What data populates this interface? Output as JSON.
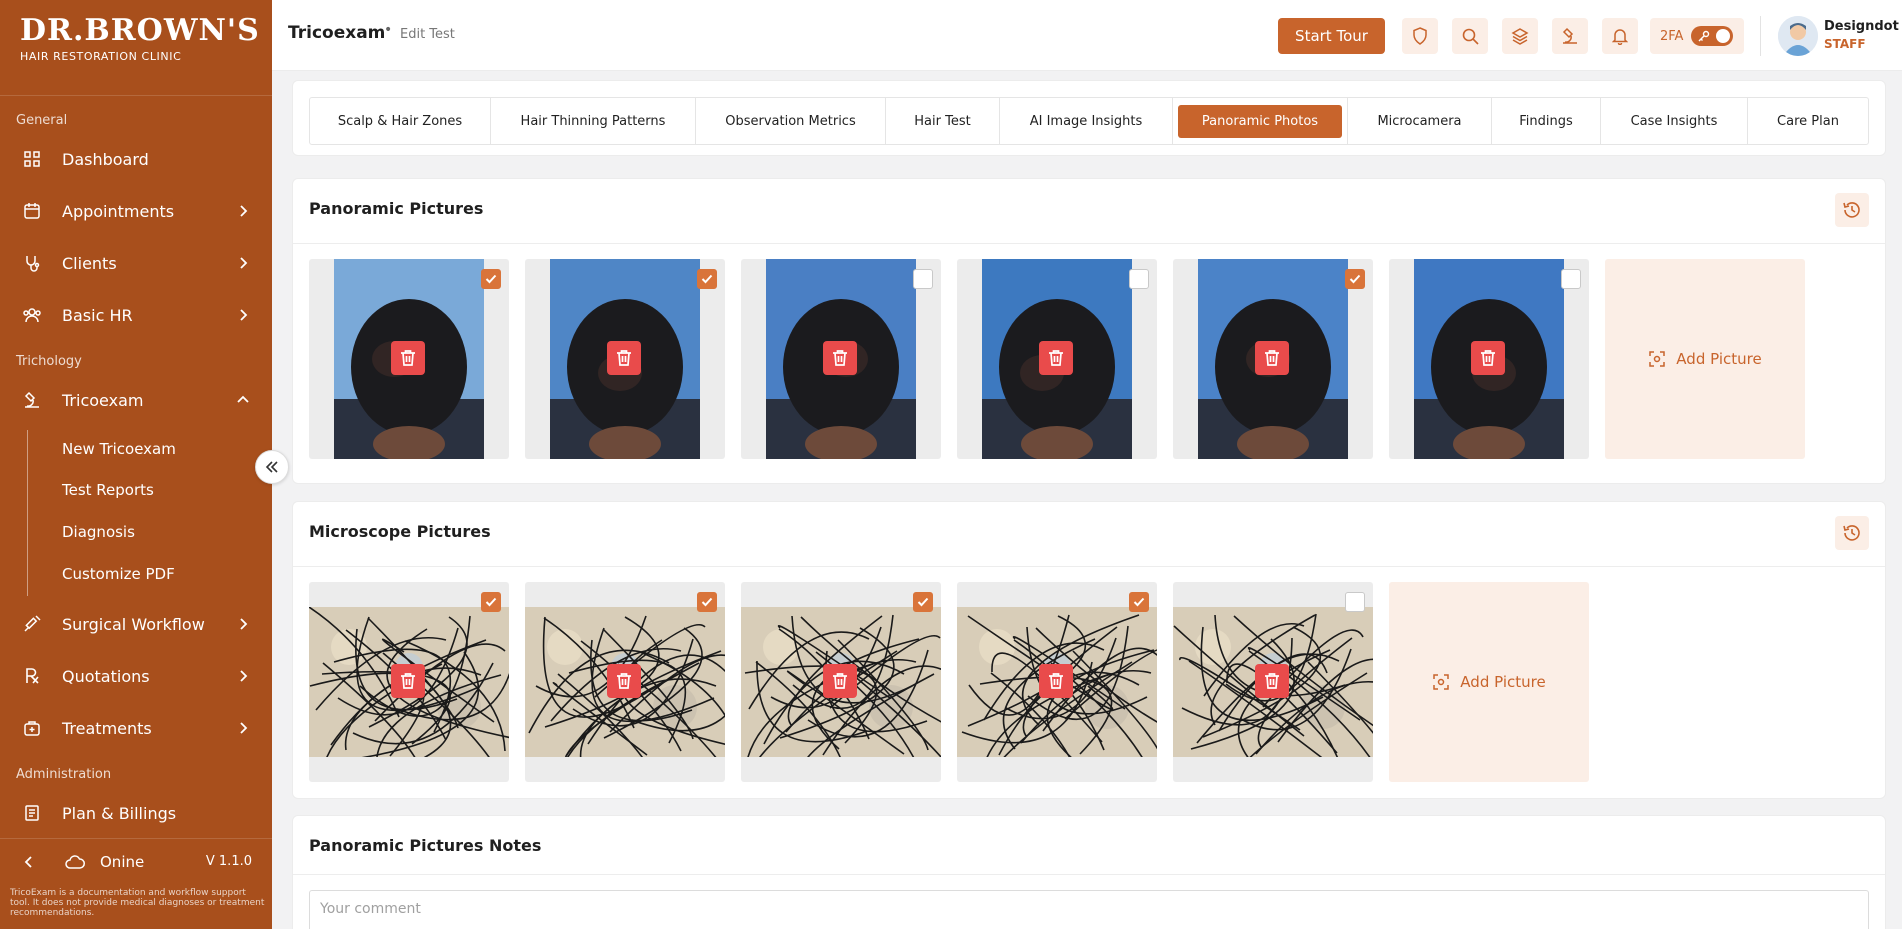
{
  "sidebar": {
    "logo_line1": "DR.BROWN'S",
    "logo_line2": "HAIR RESTORATION CLINIC",
    "section_general": "General",
    "section_trichology": "Trichology",
    "section_admin": "Administration",
    "items": {
      "dashboard": "Dashboard",
      "appointments": "Appointments",
      "clients": "Clients",
      "basic_hr": "Basic HR",
      "tricoexam": "Tricoexam",
      "surgical": "Surgical Workflow",
      "quotations": "Quotations",
      "treatments": "Treatments",
      "billing": "Plan & Billings"
    },
    "sub_items": {
      "new": "New Tricoexam",
      "reports": "Test Reports",
      "diagnosis": "Diagnosis",
      "pdf": "Customize PDF"
    },
    "status": "Onine",
    "version": "V 1.1.0",
    "disclaimer": "TricoExam is a documentation and workflow support tool. It does not provide medical diagnoses or treatment recommendations."
  },
  "header": {
    "title": "Tricoexam",
    "breadcrumb_sep": "•",
    "subtitle": "Edit Test",
    "start_tour": "Start Tour",
    "twofa": "2FA",
    "user_name": "Designdot",
    "user_role": "STAFF"
  },
  "tabs": [
    "Scalp & Hair Zones",
    "Hair Thinning Patterns",
    "Observation Metrics",
    "Hair Test",
    "AI Image Insights",
    "Panoramic Photos",
    "Microcamera",
    "Findings",
    "Case Insights",
    "Care Plan"
  ],
  "active_tab": "Panoramic Photos",
  "panoramic": {
    "title": "Panoramic Pictures",
    "add_label": "Add Picture",
    "checked": [
      true,
      true,
      false,
      false,
      true,
      false
    ]
  },
  "microscope": {
    "title": "Microscope Pictures",
    "add_label": "Add Picture",
    "checked": [
      true,
      true,
      true,
      true,
      false
    ]
  },
  "notes": {
    "title": "Panoramic Pictures Notes",
    "placeholder": "Your comment"
  },
  "colors": {
    "sidebar": "#a84f1c",
    "accent": "#c8642c",
    "delete": "#e94b4b"
  }
}
